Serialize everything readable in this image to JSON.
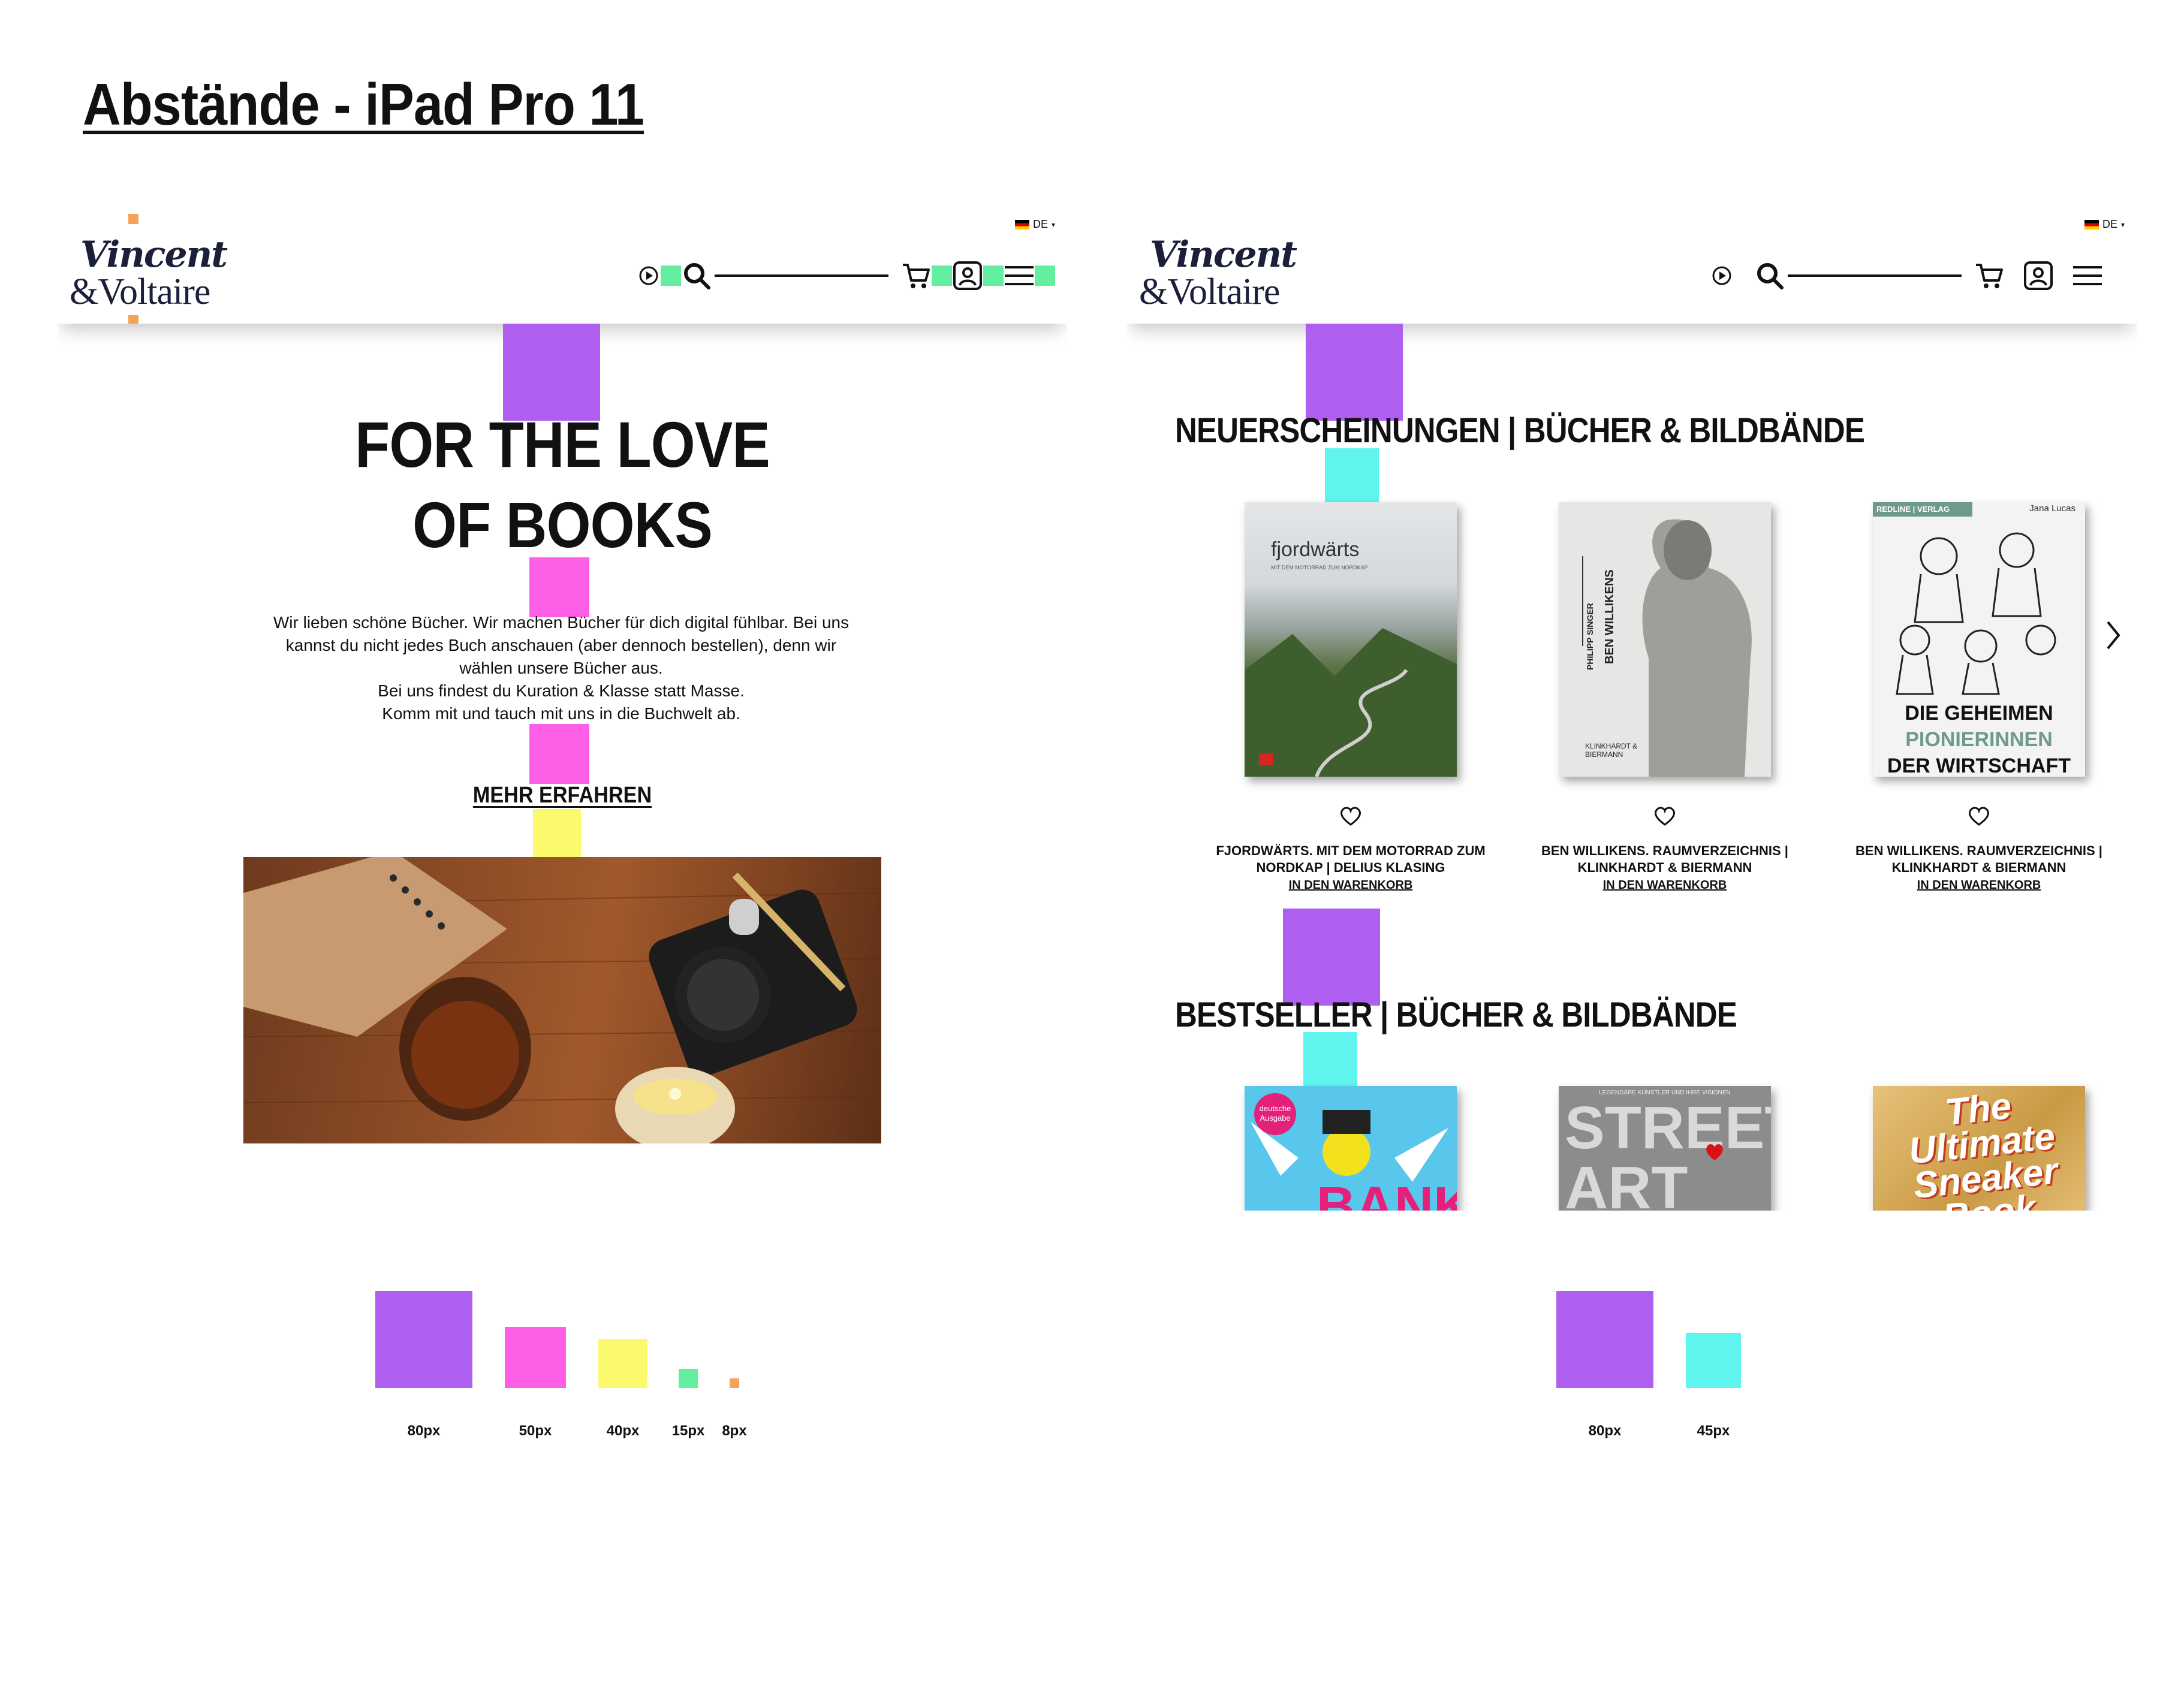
{
  "page": {
    "title": "Abstände - iPad Pro 11"
  },
  "colors": {
    "purple": "#af5fef",
    "pink": "#ff5fe6",
    "yellow": "#fafa6c",
    "green": "#62f0a0",
    "orange": "#f5a35a",
    "cyan": "#5ff5ee"
  },
  "header": {
    "logo_line1": "Vincent",
    "logo_line2": "&Voltaire",
    "language": "DE",
    "icons": [
      "play-icon",
      "search-icon",
      "cart-icon",
      "account-icon",
      "menu-icon"
    ]
  },
  "hero": {
    "title": "FOR THE LOVE OF BOOKS",
    "text_lines": [
      "Wir lieben schöne Bücher. Wir machen Bücher für dich digital fühlbar. Bei uns",
      "kannst du nicht jedes Buch anschauen (aber dennoch bestellen), denn wir",
      "wählen unsere Bücher aus.",
      "Bei uns findest du Kuration & Klasse statt Masse.",
      "Komm mit und tauch mit uns in die Buchwelt ab."
    ],
    "link": "MEHR ERFAHREN"
  },
  "new_releases": {
    "title": "NEUERSCHEINUNGEN | BÜCHER & BILDBÄNDE",
    "books": [
      {
        "cover_title": "fjordwärts",
        "cover_subtitle": "MIT DEM MOTORRAD ZUM NORDKAP",
        "title_line1": "FJORDWÄRTS. MIT DEM MOTORRAD ZUM",
        "title_line2": "NORDKAP | DELIUS KLASING",
        "cart": "IN DEN WARENKORB"
      },
      {
        "cover_title": "BEN WILLIKENS",
        "cover_author": "PHILIPP SINGER",
        "cover_publisher": "KLINKHARDT & BIERMANN",
        "title_line1": "BEN WILLIKENS. RAUMVERZEICHNIS |",
        "title_line2": "KLINKHARDT & BIERMANN",
        "cart": "IN DEN WARENKORB"
      },
      {
        "cover_badge": "REDLINE | VERLAG",
        "cover_author": "Jana Lucas",
        "cover_title_l1": "DIE GEHEIMEN",
        "cover_title_l2": "PIONIERINNEN",
        "cover_title_l3": "DER WIRTSCHAFT",
        "title_line1": "BEN WILLIKENS. RAUMVERZEICHNIS |",
        "title_line2": "KLINKHARDT & BIERMANN",
        "cart": "IN DEN WARENKORB"
      }
    ]
  },
  "bestseller": {
    "title": "BESTSELLER | BÜCHER & BILDBÄNDE",
    "books": [
      {
        "cover_badge": "deutsche Ausgabe",
        "cover_text": "BANKSY"
      },
      {
        "cover_top": "LEGENDÄRE KÜNSTLER UND IHRE VISIONEN",
        "cover_text": "STREET ART"
      },
      {
        "cover_text": "The Ultimate Sneaker Book"
      }
    ]
  },
  "legend_left": [
    {
      "label": "80px"
    },
    {
      "label": "50px"
    },
    {
      "label": "40px"
    },
    {
      "label": "15px"
    },
    {
      "label": "8px"
    }
  ],
  "legend_right": [
    {
      "label": "80px"
    },
    {
      "label": "45px"
    }
  ]
}
